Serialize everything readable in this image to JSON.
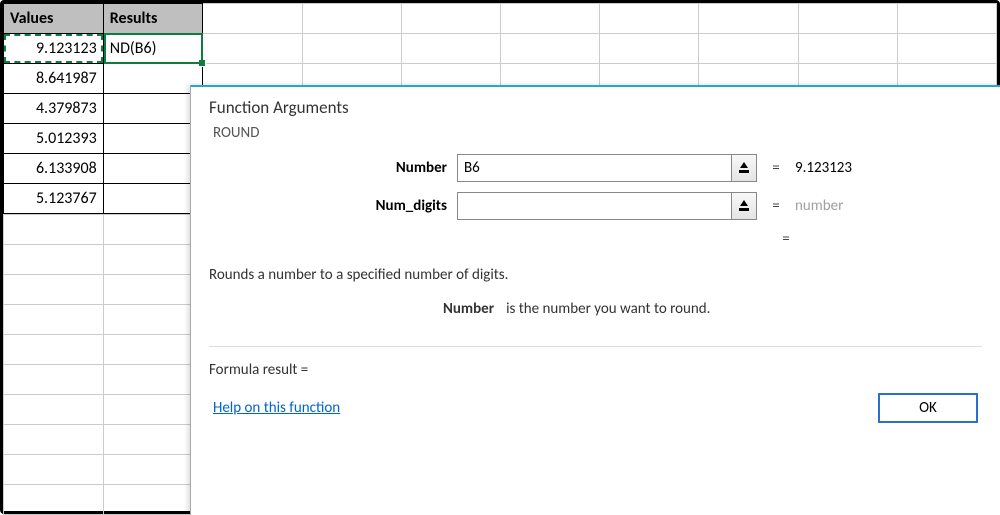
{
  "sheet": {
    "headers": {
      "a": "Values",
      "b": "Results"
    },
    "rows": [
      {
        "value": "9.123123",
        "result": "ND(B6)"
      },
      {
        "value": "8.641987",
        "result": ""
      },
      {
        "value": "4.379873",
        "result": ""
      },
      {
        "value": "5.012393",
        "result": ""
      },
      {
        "value": "6.133908",
        "result": ""
      },
      {
        "value": "5.123767",
        "result": ""
      }
    ]
  },
  "dialog": {
    "title": "Function Arguments",
    "function_name": "ROUND",
    "args": {
      "number": {
        "label": "Number",
        "value": "B6",
        "evaluated": "9.123123"
      },
      "num_digits": {
        "label": "Num_digits",
        "value": "",
        "evaluated_placeholder": "number"
      }
    },
    "eq": "=",
    "description": "Rounds a number to a specified number of digits.",
    "arg_description": {
      "argname": "Number",
      "text": "is the number you want to round."
    },
    "formula_result_label": "Formula result =",
    "formula_result_value": "",
    "help_link": "Help on this function",
    "ok_label": "OK"
  }
}
